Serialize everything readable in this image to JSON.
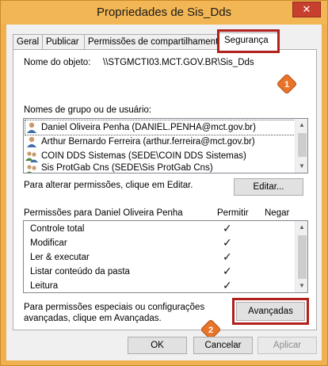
{
  "window": {
    "title": "Propriedades de Sis_Dds",
    "close_symbol": "✕"
  },
  "tabs": [
    {
      "label": "Geral"
    },
    {
      "label": "Publicar"
    },
    {
      "label": "Permissões de compartilhamento"
    },
    {
      "label": "Segurança"
    }
  ],
  "security": {
    "object_name_label": "Nome do objeto:",
    "object_name_value": "\\\\STGMCTI03.MCT.GOV.BR\\Sis_Dds",
    "groups_label": "Nomes de grupo ou de usuário:",
    "groups": [
      {
        "name": "Daniel Oliveira Penha (DANIEL.PENHA@mct.gov.br)",
        "icon": "user-icon"
      },
      {
        "name": "Arthur Bernardo Ferreira (arthur.ferreira@mct.gov.br)",
        "icon": "user-icon"
      },
      {
        "name": "COIN DDS Sistemas (SEDE\\COIN DDS Sistemas)",
        "icon": "group-icon"
      },
      {
        "name": "Sis ProtGab Cns (SEDE\\Sis ProtGab Cns)",
        "icon": "group-icon"
      }
    ],
    "edit_hint": "Para alterar permissões, clique em Editar.",
    "edit_button": "Editar...",
    "permissions_header": "Permissões para Daniel Oliveira Penha",
    "allow_header": "Permitir",
    "deny_header": "Negar",
    "permissions": [
      {
        "name": "Controle total",
        "allow": true,
        "deny": false
      },
      {
        "name": "Modificar",
        "allow": true,
        "deny": false
      },
      {
        "name": "Ler & executar",
        "allow": true,
        "deny": false
      },
      {
        "name": "Listar conteúdo da pasta",
        "allow": true,
        "deny": false
      },
      {
        "name": "Leitura",
        "allow": true,
        "deny": false
      }
    ],
    "check_symbol": "✓",
    "advanced_hint_line1": "Para permissões especiais ou configurações",
    "advanced_hint_line2": "avançadas, clique em Avançadas.",
    "advanced_button": "Avançadas"
  },
  "footer": {
    "ok_button": "OK",
    "cancel_button": "Cancelar",
    "apply_button": "Aplicar"
  },
  "callouts": [
    {
      "number": "1"
    },
    {
      "number": "2"
    }
  ],
  "colors": {
    "window_frame": "#f0b050",
    "highlight_red": "#b0201c",
    "callout_orange": "#e8742a"
  }
}
